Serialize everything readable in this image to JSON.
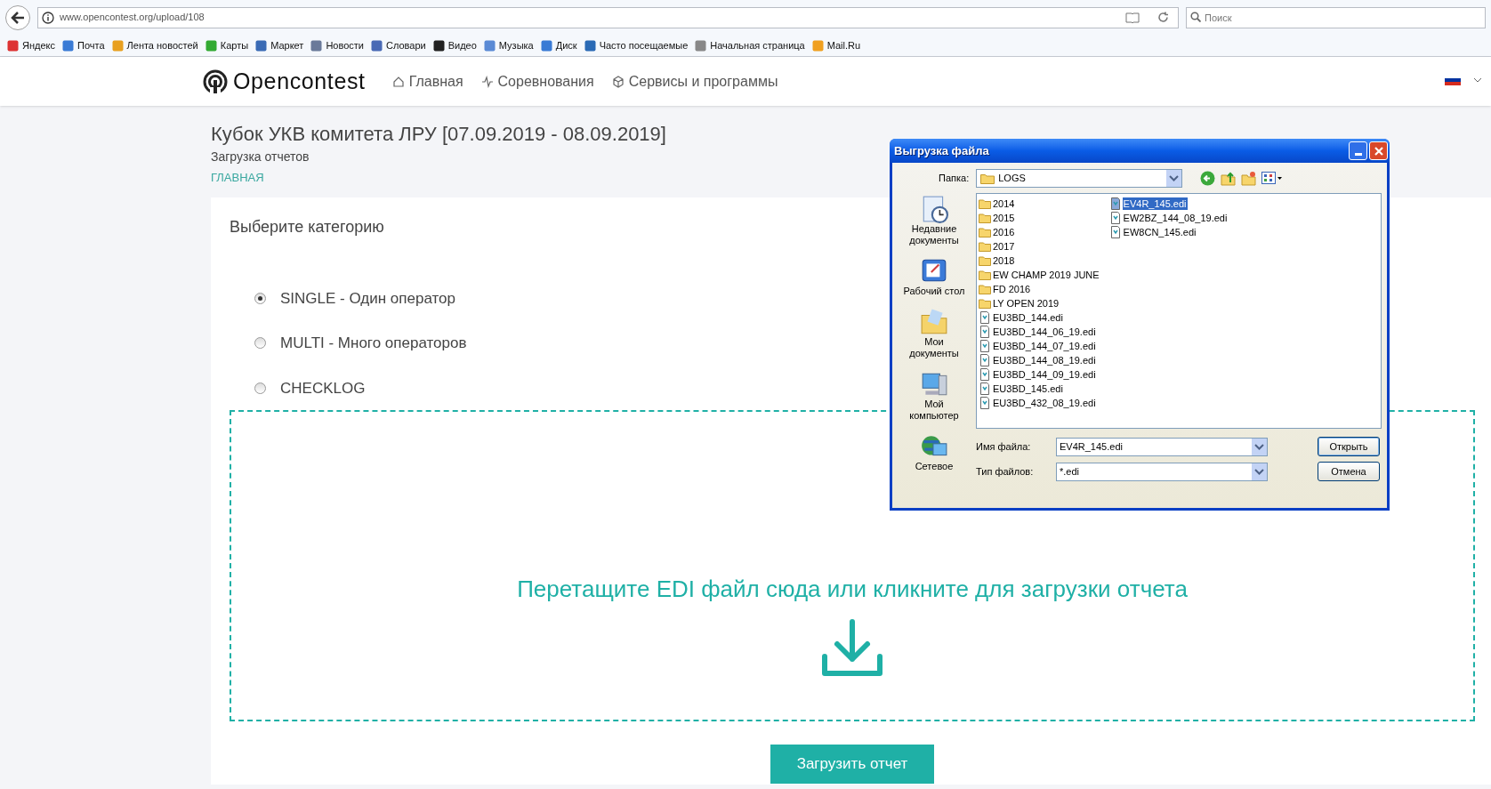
{
  "browser": {
    "url": "www.opencontest.org/upload/108",
    "search_placeholder": "Поиск",
    "bookmarks": [
      "Яндекс",
      "Почта",
      "Лента новостей",
      "Карты",
      "Маркет",
      "Новости",
      "Словари",
      "Видео",
      "Музыка",
      "Диск",
      "Часто посещаемые",
      "Начальная страница",
      "Mail.Ru"
    ]
  },
  "site": {
    "logo": "Opencontest",
    "nav": [
      "Главная",
      "Соревнования",
      "Сервисы и программы"
    ]
  },
  "page": {
    "title": "Кубок УКВ комитета ЛРУ [07.09.2019 - 08.09.2019]",
    "subtitle": "Загрузка отчетов",
    "breadcrumb": "ГЛАВНАЯ",
    "category_heading": "Выберите категорию",
    "categories": [
      {
        "label": "SINGLE - Один оператор",
        "selected": true
      },
      {
        "label": "MULTI - Много операторов",
        "selected": false
      },
      {
        "label": "CHECKLOG",
        "selected": false
      }
    ],
    "dropzone_text": "Перетащите EDI файл сюда или кликните для загрузки отчета",
    "upload_button": "Загрузить отчет"
  },
  "dialog": {
    "title": "Выгрузка файла",
    "folder_label": "Папка:",
    "folder": "LOGS",
    "places": [
      "Недавние документы",
      "Рабочий стол",
      "Мои документы",
      "Мой компьютер",
      "Сетевое"
    ],
    "files": [
      {
        "name": "2014",
        "kind": "folder",
        "selected": false
      },
      {
        "name": "2015",
        "kind": "folder",
        "selected": false
      },
      {
        "name": "2016",
        "kind": "folder",
        "selected": false
      },
      {
        "name": "2017",
        "kind": "folder",
        "selected": false
      },
      {
        "name": "2018",
        "kind": "folder",
        "selected": false
      },
      {
        "name": "EW CHAMP 2019 JUNE",
        "kind": "folder",
        "selected": false
      },
      {
        "name": "FD 2016",
        "kind": "folder",
        "selected": false
      },
      {
        "name": "LY OPEN 2019",
        "kind": "folder",
        "selected": false
      },
      {
        "name": "EU3BD_144.edi",
        "kind": "file",
        "selected": false
      },
      {
        "name": "EU3BD_144_06_19.edi",
        "kind": "file",
        "selected": false
      },
      {
        "name": "EU3BD_144_07_19.edi",
        "kind": "file",
        "selected": false
      },
      {
        "name": "EU3BD_144_08_19.edi",
        "kind": "file",
        "selected": false
      },
      {
        "name": "EU3BD_144_09_19.edi",
        "kind": "file",
        "selected": false
      },
      {
        "name": "EU3BD_145.edi",
        "kind": "file",
        "selected": false
      },
      {
        "name": "EU3BD_432_08_19.edi",
        "kind": "file",
        "selected": false
      },
      {
        "name": "EV4R_145.edi",
        "kind": "file",
        "selected": true
      },
      {
        "name": "EW2BZ_144_08_19.edi",
        "kind": "file",
        "selected": false
      },
      {
        "name": "EW8CN_145.edi",
        "kind": "file",
        "selected": false
      }
    ],
    "filename_label": "Имя файла:",
    "filename": "EV4R_145.edi",
    "filetype_label": "Тип файлов:",
    "filetype": "*.edi",
    "open_button": "Открыть",
    "cancel_button": "Отмена"
  }
}
